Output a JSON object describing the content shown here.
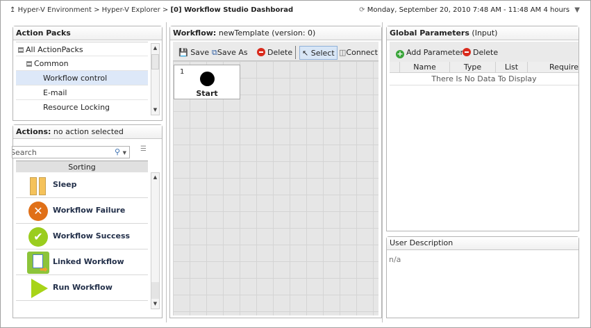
{
  "breadcrumb": {
    "items": [
      "Hyper-V Environment",
      "Hyper-V Explorer"
    ],
    "current": "[0] Workflow Studio Dashborad"
  },
  "time_range": "Monday, September 20, 2010 7:48 AM - 11:48 AM 4 hours",
  "action_packs": {
    "title": "Action Packs",
    "items": [
      {
        "label": "All ActionPacks",
        "level": 0,
        "expanded": true
      },
      {
        "label": "Common",
        "level": 1,
        "expanded": true
      },
      {
        "label": "Workflow control",
        "level": 2,
        "selected": true
      },
      {
        "label": "E-mail",
        "level": 2
      },
      {
        "label": "Resource Locking",
        "level": 2
      }
    ]
  },
  "actions": {
    "title": "Actions:",
    "subtitle": "no action selected",
    "search_placeholder": "Search",
    "sorting_header": "Sorting",
    "items": [
      {
        "label": "Sleep",
        "icon": "pause-icon"
      },
      {
        "label": "Workflow Failure",
        "icon": "failure-icon"
      },
      {
        "label": "Workflow Success",
        "icon": "success-icon"
      },
      {
        "label": "Linked Workflow",
        "icon": "linked-workflow-icon"
      },
      {
        "label": "Run Workflow",
        "icon": "play-icon"
      }
    ]
  },
  "workflow": {
    "title": "Workflow:",
    "name": "newTemplate (version: 0)",
    "toolbar": {
      "save": "Save",
      "save_as": "Save As",
      "delete": "Delete",
      "select": "Select",
      "connect": "Connect"
    },
    "start_node": {
      "number": "1",
      "label": "Start"
    }
  },
  "global_params": {
    "title": "Global Parameters",
    "subtitle": "(Input)",
    "add": "Add Parameter",
    "delete": "Delete",
    "columns": [
      "Name",
      "Type",
      "List",
      "Require"
    ],
    "empty": "There Is No Data To Display"
  },
  "user_description": {
    "title": "User Description",
    "value": "n/a"
  },
  "colors": {
    "selected_row": "#dde8f8",
    "header_bg": "#f0f0f0",
    "delete_red": "#d92a1c",
    "add_green": "#3aa53a"
  }
}
